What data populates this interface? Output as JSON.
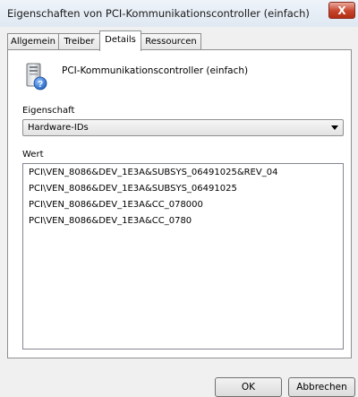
{
  "window": {
    "title": "Eigenschaften von PCI-Kommunikationscontroller (einfach)",
    "close_glyph": "X"
  },
  "tabs": [
    {
      "label": "Allgemein",
      "active": false
    },
    {
      "label": "Treiber",
      "active": false
    },
    {
      "label": "Details",
      "active": true
    },
    {
      "label": "Ressourcen",
      "active": false
    }
  ],
  "device": {
    "icon": "pci-device-unknown-icon",
    "name": "PCI-Kommunikationscontroller (einfach)"
  },
  "property": {
    "label": "Eigenschaft",
    "selected": "Hardware-IDs"
  },
  "value": {
    "label": "Wert",
    "items": [
      "PCI\\VEN_8086&DEV_1E3A&SUBSYS_06491025&REV_04",
      "PCI\\VEN_8086&DEV_1E3A&SUBSYS_06491025",
      "PCI\\VEN_8086&DEV_1E3A&CC_078000",
      "PCI\\VEN_8086&DEV_1E3A&CC_0780"
    ]
  },
  "buttons": {
    "ok": "OK",
    "cancel": "Abbrechen"
  },
  "colors": {
    "close_button": "#c7432b",
    "window_bg": "#f0f0f0"
  }
}
